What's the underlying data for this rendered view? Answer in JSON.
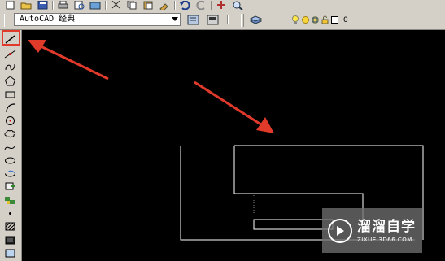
{
  "workspace": {
    "selected": "AutoCAD 经典"
  },
  "layer": {
    "name": "0"
  },
  "watermark": {
    "title": "溜溜自学",
    "url": "ZIXUE.3D66.COM"
  },
  "top_toolbar": {
    "icons": [
      "new-file-icon",
      "open-file-icon",
      "save-icon",
      "print-icon",
      "preview-icon",
      "publish-icon",
      "cut-icon",
      "copy-icon",
      "paste-icon",
      "match-properties-icon",
      "undo-icon",
      "redo-icon",
      "pan-icon",
      "zoom-icon"
    ]
  },
  "draw_toolbar": {
    "icons": [
      "line-icon",
      "construction-line-icon",
      "polyline-icon",
      "polygon-icon",
      "rectangle-icon",
      "arc-icon",
      "circle-icon",
      "revision-cloud-icon",
      "spline-icon",
      "ellipse-icon",
      "ellipse-arc-icon",
      "insert-block-icon",
      "make-block-icon",
      "point-icon",
      "hatch-icon",
      "gradient-icon",
      "region-icon"
    ]
  },
  "colors": {
    "chrome": "#d4d0c8",
    "canvas": "#000000",
    "annotation": "#e03a2a",
    "geometry": "#ffffff"
  }
}
